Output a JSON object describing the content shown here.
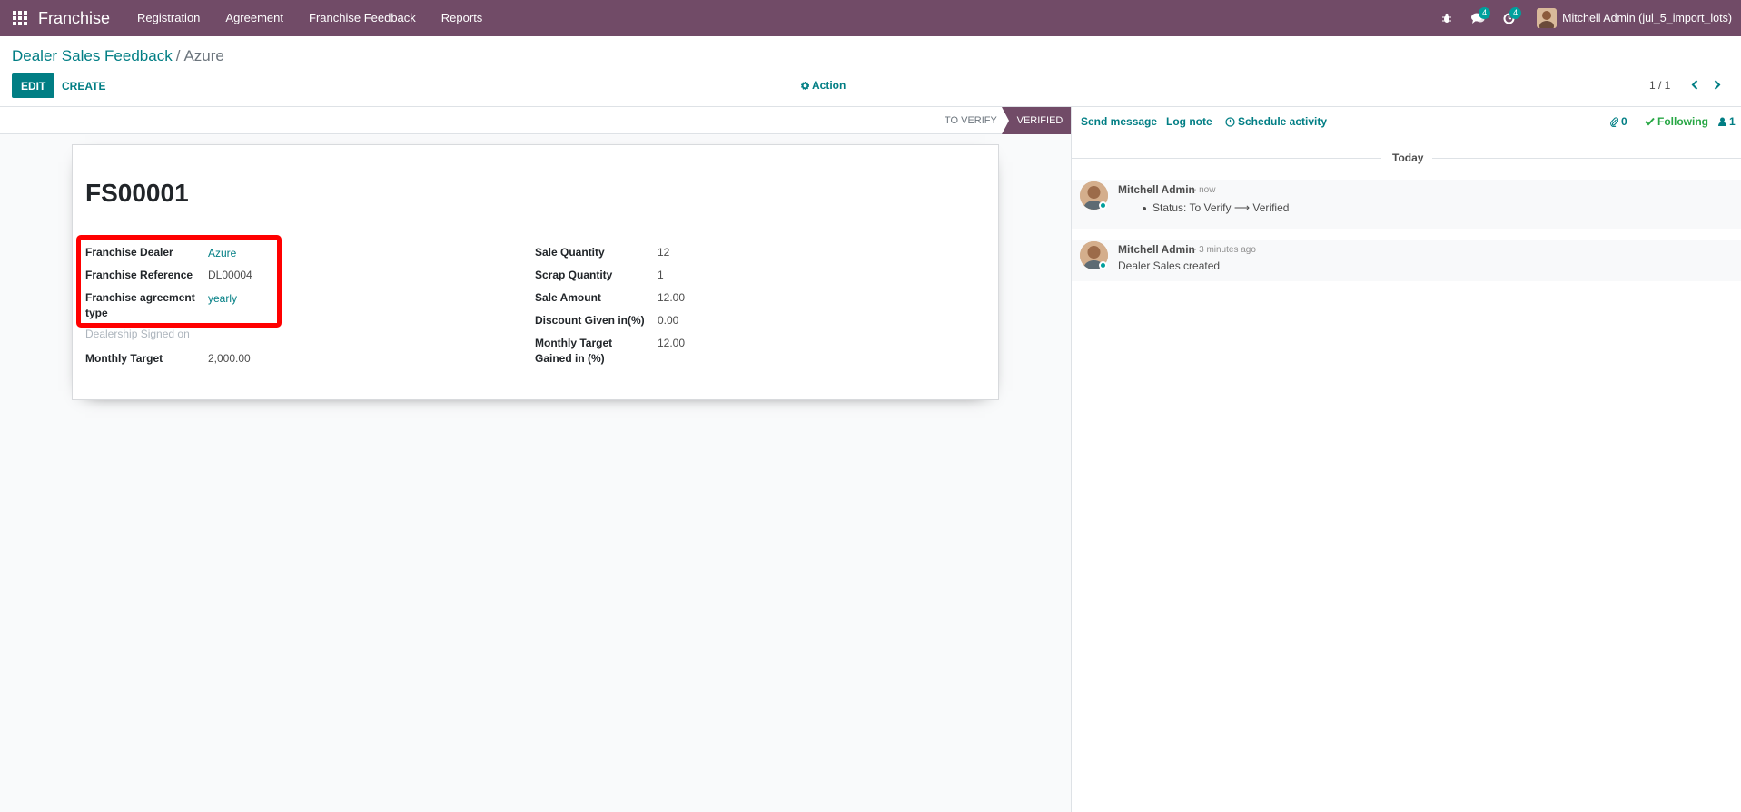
{
  "navbar": {
    "app_name": "Franchise",
    "menu": [
      "Registration",
      "Agreement",
      "Franchise Feedback",
      "Reports"
    ],
    "messages_count": "4",
    "activities_count": "4",
    "user_name": "Mitchell Admin (jul_5_import_lots)"
  },
  "control_panel": {
    "breadcrumb_parent": "Dealer Sales Feedback",
    "breadcrumb_separator": "/",
    "breadcrumb_current": "Azure",
    "edit_label": "EDIT",
    "create_label": "CREATE",
    "action_label": "Action",
    "pager": "1 / 1"
  },
  "statusbar": {
    "stages": [
      "TO VERIFY",
      "VERIFIED"
    ],
    "active_stage": "VERIFIED"
  },
  "form": {
    "title": "FS00001",
    "left_fields": [
      {
        "label": "Franchise Dealer",
        "value": "Azure"
      },
      {
        "label": "Franchise Reference",
        "value": "DL00004"
      },
      {
        "label": "Franchise agreement type",
        "value": "yearly"
      },
      {
        "label": "Dealership Signed on",
        "value": ""
      },
      {
        "label": "Monthly Target",
        "value": "2,000.00"
      }
    ],
    "right_fields": [
      {
        "label": "Sale Quantity",
        "value": "12"
      },
      {
        "label": "Scrap Quantity",
        "value": "1"
      },
      {
        "label": "Sale Amount",
        "value": "12.00"
      },
      {
        "label": "Discount Given in(%)",
        "value": "0.00"
      },
      {
        "label": "Monthly Target Gained in (%)",
        "value": "12.00"
      }
    ]
  },
  "chatter": {
    "send_message": "Send message",
    "log_note": "Log note",
    "schedule_activity": "Schedule activity",
    "attachments_count": "0",
    "following": "Following",
    "followers_count": "1",
    "date_separator": "Today",
    "messages": [
      {
        "author": "Mitchell Admin",
        "date": "- now",
        "body_from": "Status: To Verify",
        "arrow": "⟶",
        "body_to": "Verified"
      },
      {
        "author": "Mitchell Admin",
        "date": "- 3 minutes ago",
        "body": "Dealer Sales created"
      }
    ]
  },
  "colors": {
    "brand": "#714b67",
    "accent": "#017e84",
    "highlight": "#ff0000",
    "following": "#28a745",
    "badge": "#00a09d"
  }
}
